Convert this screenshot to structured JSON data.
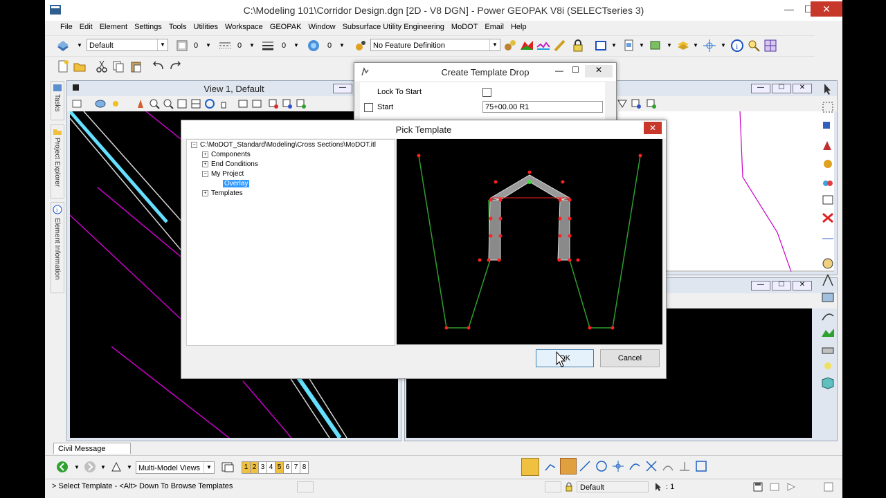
{
  "window": {
    "title": "C:\\Modeling 101\\Corridor Design.dgn [2D - V8 DGN] - Power GEOPAK V8i (SELECTseries 3)",
    "minimize": "—",
    "maximize": "☐",
    "close": "✕"
  },
  "menu": [
    "File",
    "Edit",
    "Element",
    "Settings",
    "Tools",
    "Utilities",
    "Workspace",
    "GEOPAK",
    "Window",
    "Subsurface Utility Engineering",
    "MoDOT",
    "Email",
    "Help"
  ],
  "toolbar": {
    "level_combo": "Default",
    "color_value": "0",
    "style_value": "0",
    "weight_value": "0",
    "transparency_value": "0",
    "feature_combo": "No Feature Definition"
  },
  "side_tabs": [
    "Tasks",
    "Project Explorer",
    "Element Information"
  ],
  "view1": {
    "title": "View 1, Default"
  },
  "create_template_drop": {
    "title": "Create Template Drop",
    "lock_to_start_label": "Lock To Start",
    "start_label": "Start",
    "start_value": "75+00.00 R1",
    "min": "—",
    "max": "☐",
    "close": "✕"
  },
  "pick_template": {
    "title": "Pick Template",
    "close": "✕",
    "tree": {
      "root": "C:\\MoDOT_Standard\\Modeling\\Cross Sections\\MoDOT.itl",
      "items": [
        "Components",
        "End Conditions",
        "My Project",
        "Overlay",
        "Templates"
      ]
    },
    "ok_label": "OK",
    "cancel_label": "Cancel"
  },
  "civil_message_center": "Civil Message Center",
  "bottom_bar": {
    "views_combo": "Multi-Model Views",
    "view_numbers": [
      "1",
      "2",
      "3",
      "4",
      "5",
      "6",
      "7",
      "8"
    ]
  },
  "status": {
    "prompt": "> Select Template - <Alt> Down To Browse Templates",
    "level": "Default",
    "count": ": 1"
  },
  "colors": {
    "magenta": "#c800c8",
    "cyan": "#66e0ff",
    "template_green": "#2e9e2e",
    "template_red": "#ff2020",
    "selection_blue": "#3399ff"
  }
}
